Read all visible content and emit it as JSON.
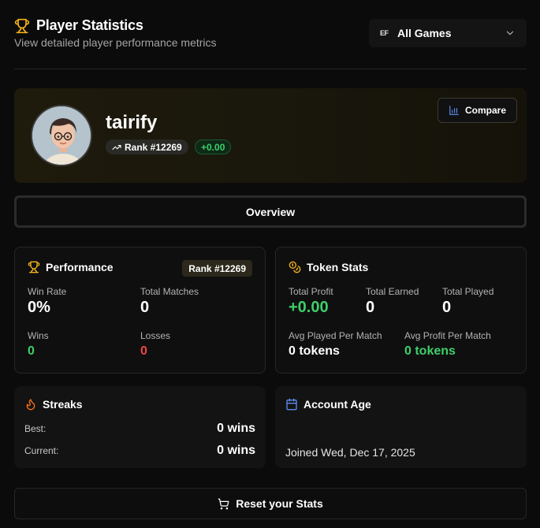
{
  "header": {
    "title": "Player Statistics",
    "subtitle": "View detailed player performance metrics"
  },
  "game_select": {
    "logo_text": "EF",
    "selected": "All Games"
  },
  "profile": {
    "username": "tairify",
    "rank": "Rank #12269",
    "delta": "+0.00",
    "compare_label": "Compare"
  },
  "tabs": [
    {
      "label": "Overview",
      "active": true
    }
  ],
  "performance": {
    "title": "Performance",
    "rank_badge": "Rank #12269",
    "win_rate_label": "Win Rate",
    "win_rate": "0%",
    "total_matches_label": "Total Matches",
    "total_matches": "0",
    "wins_label": "Wins",
    "wins": "0",
    "losses_label": "Losses",
    "losses": "0"
  },
  "tokens": {
    "title": "Token Stats",
    "total_profit_label": "Total Profit",
    "total_profit": "+0.00",
    "total_earned_label": "Total Earned",
    "total_earned": "0",
    "total_played_label": "Total Played",
    "total_played": "0",
    "avg_played_label": "Avg Played Per Match",
    "avg_played": "0 tokens",
    "avg_profit_label": "Avg Profit Per Match",
    "avg_profit": "0 tokens"
  },
  "streaks": {
    "title": "Streaks",
    "best_label": "Best:",
    "best": "0 wins",
    "current_label": "Current:",
    "current": "0 wins"
  },
  "account_age": {
    "title": "Account Age",
    "joined": "Joined Wed, Dec 17, 2025"
  },
  "reset": {
    "label": "Reset your Stats"
  },
  "colors": {
    "accent_gold": "#f5b21b",
    "positive": "#3ecf6a",
    "negative": "#ef4444",
    "chart_blue": "#5b8def",
    "streak_orange": "#f97316"
  }
}
